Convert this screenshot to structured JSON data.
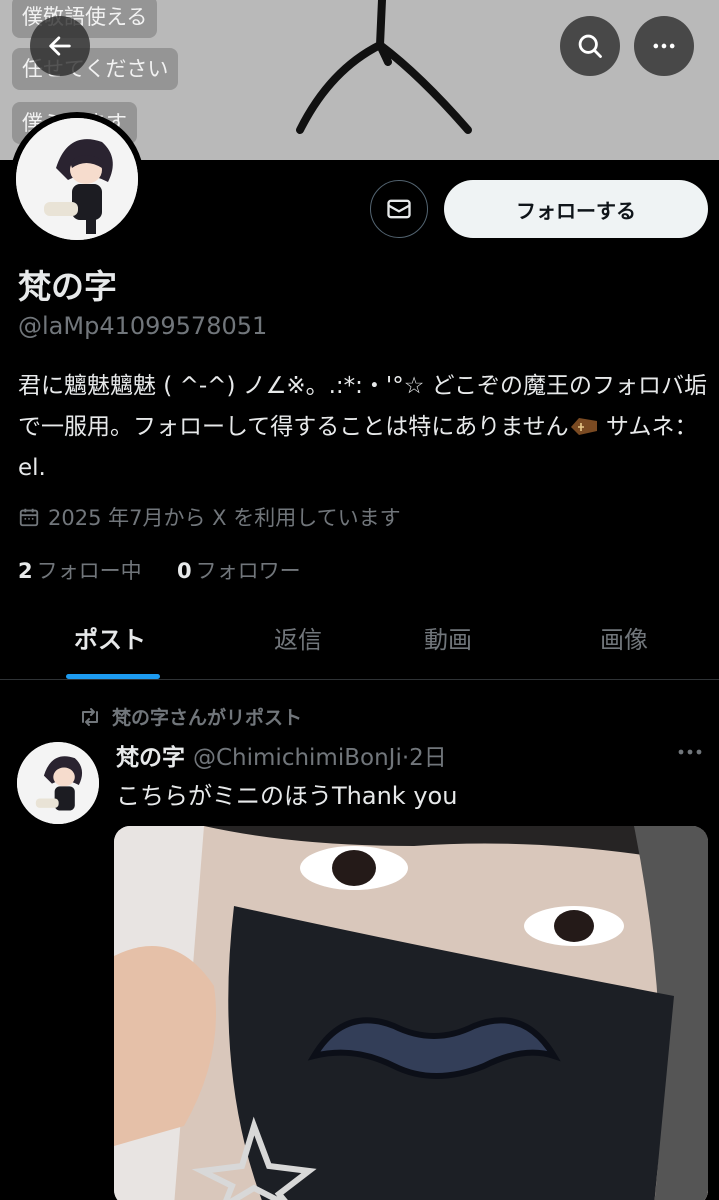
{
  "banner": {
    "labels": [
      "僕敬語使える",
      "任せてください",
      "僕ミケます"
    ]
  },
  "nav": {
    "back_icon": "arrow-left-icon",
    "search_icon": "search-icon",
    "more_icon": "more-horizontal-icon"
  },
  "profile": {
    "display_name": "梵の字",
    "handle": "@laMp41099578051",
    "bio_text": "君に魑魅魑魅 ( ^-^) ノ∠※。.:*:・'°☆ どこぞの魔王のフォロバ垢で一服用。フォローして得することは特にありません",
    "bio_tail": " サムネ：el.",
    "joined": "2025 年7月から X を利用しています",
    "following_count": "2",
    "following_label": "フォロー中",
    "followers_count": "0",
    "followers_label": "フォロワー",
    "follow_button": "フォローする"
  },
  "tabs": [
    "ポスト",
    "返信",
    "動画",
    "画像"
  ],
  "active_tab": "ポスト",
  "post": {
    "repost_label": "梵の字さんがリポスト",
    "author_name": "梵の字",
    "author_handle": "@ChimichimiBonJi",
    "time": "2日",
    "text": "こちらがミニのほうThank you"
  },
  "colors": {
    "background": "#000000",
    "accent": "#1d9bf0",
    "text_primary": "#e7e9ea",
    "text_secondary": "#71767b"
  }
}
